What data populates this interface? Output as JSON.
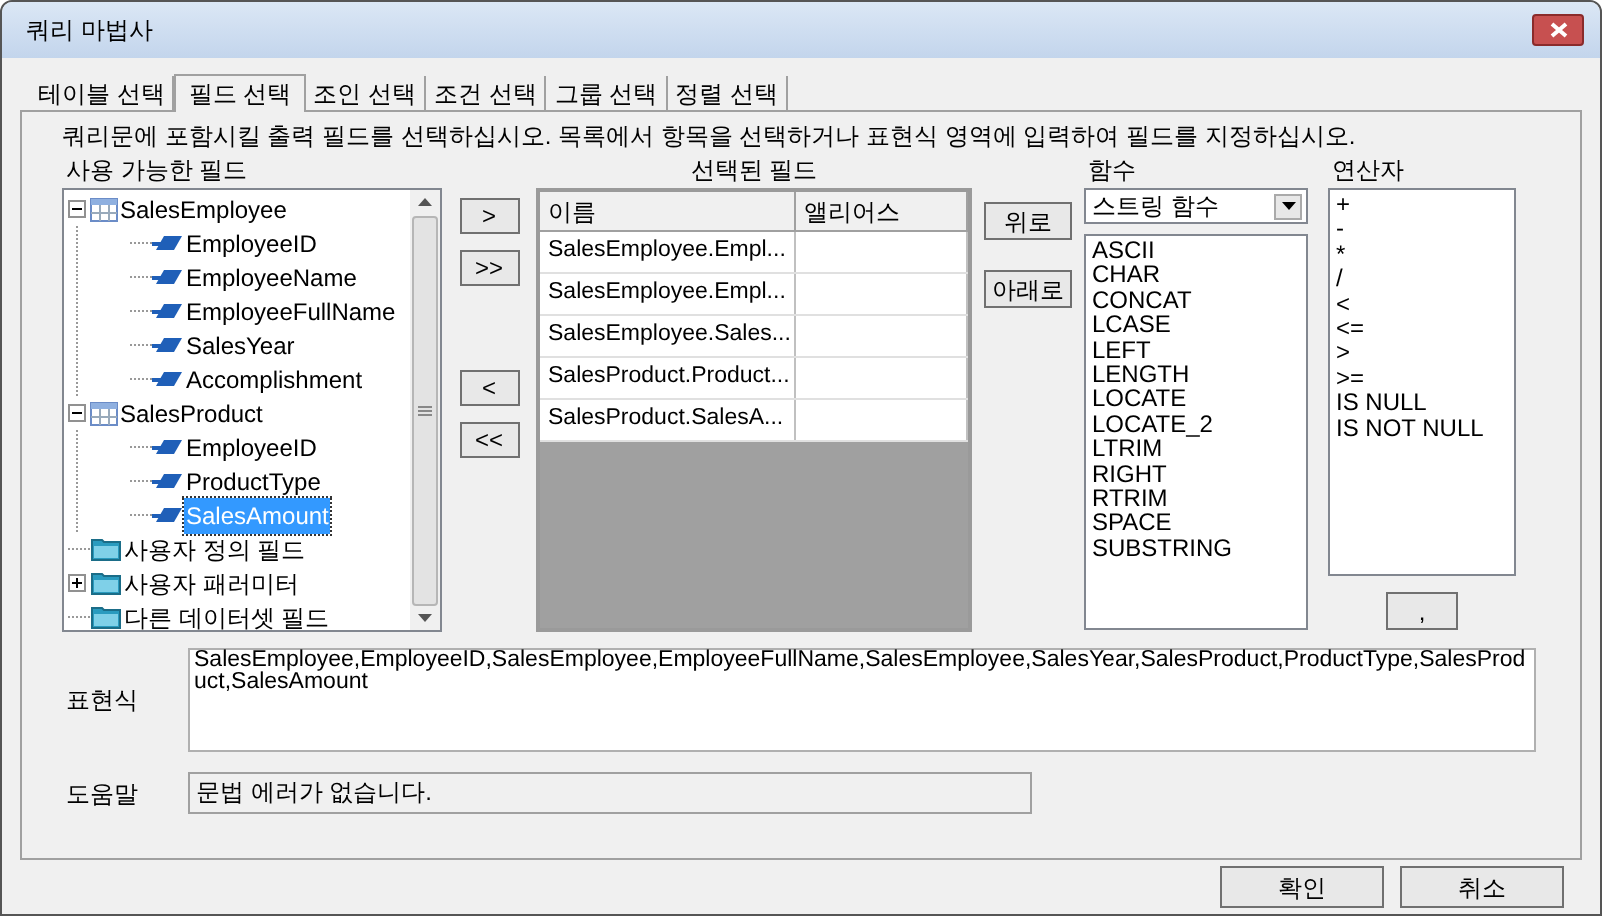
{
  "window": {
    "title": "쿼리 마법사"
  },
  "tabs": [
    {
      "label": "테이블 선택",
      "selected": false
    },
    {
      "label": "필드 선택",
      "selected": true
    },
    {
      "label": "조인 선택",
      "selected": false
    },
    {
      "label": "조건 선택",
      "selected": false
    },
    {
      "label": "그룹 선택",
      "selected": false
    },
    {
      "label": "정렬 선택",
      "selected": false
    }
  ],
  "instruction": "쿼리문에 포함시킬 출력 필드를 선택하십시오. 목록에서 항목을 선택하거나 표현식 영역에 입력하여 필드를 지정하십시오.",
  "available_fields": {
    "label": "사용 가능한 필드",
    "items": [
      {
        "kind": "table",
        "label": "SalesEmployee",
        "expanded": true,
        "selected": false,
        "children": [
          {
            "kind": "field",
            "label": "EmployeeID",
            "selected": false
          },
          {
            "kind": "field",
            "label": "EmployeeName",
            "selected": false
          },
          {
            "kind": "field",
            "label": "EmployeeFullName",
            "selected": false
          },
          {
            "kind": "field",
            "label": "SalesYear",
            "selected": false
          },
          {
            "kind": "field",
            "label": "Accomplishment",
            "selected": false
          }
        ]
      },
      {
        "kind": "table",
        "label": "SalesProduct",
        "expanded": true,
        "selected": false,
        "children": [
          {
            "kind": "field",
            "label": "EmployeeID",
            "selected": false
          },
          {
            "kind": "field",
            "label": "ProductType",
            "selected": false
          },
          {
            "kind": "field",
            "label": "SalesAmount",
            "selected": true
          }
        ]
      },
      {
        "kind": "folder",
        "label": "사용자 정의 필드",
        "selected": false
      },
      {
        "kind": "folder",
        "label": "사용자 패러미터",
        "expanded": false,
        "selected": false
      },
      {
        "kind": "folder",
        "label": "다른 데이터셋 필드",
        "selected": false
      }
    ]
  },
  "move_buttons": [
    ">",
    ">>",
    "<",
    "<<"
  ],
  "selected_fields": {
    "label": "선택된 필드",
    "columns": [
      "이름",
      "앨리어스"
    ],
    "rows": [
      [
        "SalesEmployee.Empl...",
        ""
      ],
      [
        "SalesEmployee.Empl...",
        ""
      ],
      [
        "SalesEmployee.Sales...",
        ""
      ],
      [
        "SalesProduct.Product...",
        ""
      ],
      [
        "SalesProduct.SalesA...",
        ""
      ]
    ]
  },
  "order_buttons": [
    "위로",
    "아래로"
  ],
  "functions": {
    "label": "함수",
    "category": "스트링 함수",
    "items": [
      "ASCII",
      "CHAR",
      "CONCAT",
      "LCASE",
      "LEFT",
      "LENGTH",
      "LOCATE",
      "LOCATE_2",
      "LTRIM",
      "RIGHT",
      "RTRIM",
      "SPACE",
      "SUBSTRING"
    ]
  },
  "operators": {
    "label": "연산자",
    "items": [
      "+",
      "-",
      "*",
      "/",
      "<",
      "<=",
      ">",
      ">=",
      "IS NULL",
      "IS NOT NULL"
    ],
    "button": ","
  },
  "expression": {
    "label": "표현식",
    "value": "SalesEmployee,EmployeeID,SalesEmployee,EmployeeFullName,SalesEmployee,SalesYear,SalesProduct,ProductType,SalesProduct,SalesAmount"
  },
  "help": {
    "label": "도움말",
    "value": "문법 에러가 없습니다."
  },
  "buttons": [
    "확인",
    "취소"
  ]
}
